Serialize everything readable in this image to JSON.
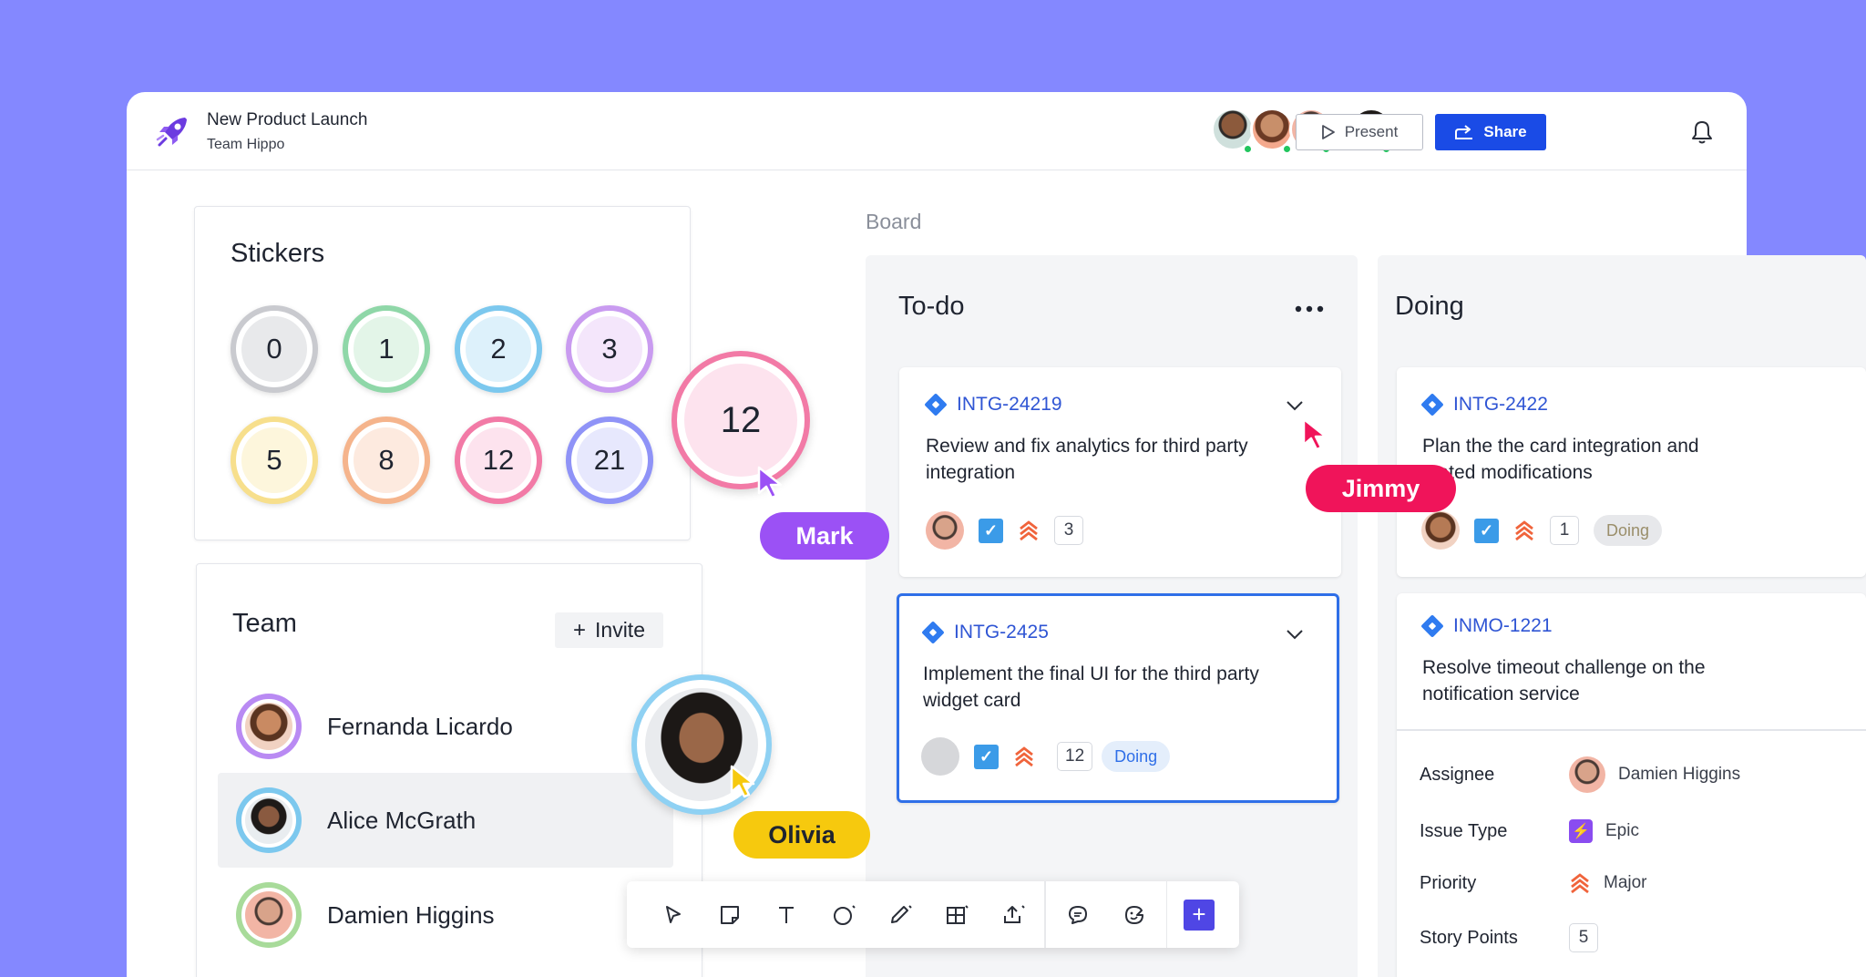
{
  "header": {
    "project_title": "New Product Launch",
    "project_subtitle": "Team Hippo",
    "present_label": "Present",
    "share_label": "Share"
  },
  "stickers": {
    "title": "Stickers",
    "items": [
      "0",
      "1",
      "2",
      "3",
      "5",
      "8",
      "12",
      "21"
    ]
  },
  "floating_sticker": {
    "value": "12"
  },
  "team": {
    "title": "Team",
    "invite_label": "Invite",
    "members": [
      "Fernanda Licardo",
      "Alice McGrath",
      "Damien Higgins"
    ]
  },
  "board": {
    "label": "Board",
    "columns": [
      {
        "title": "To-do",
        "cards": [
          {
            "id": "INTG-24219",
            "text": "Review and fix analytics for third party integration",
            "count": "3"
          },
          {
            "id": "INTG-2425",
            "text": "Implement the final UI for the third party widget card",
            "count": "12",
            "status": "Doing"
          }
        ]
      },
      {
        "title": "Doing",
        "cards": [
          {
            "id": "INTG-2422",
            "text": "Plan the the card integration and ...ated modifications",
            "count": "1",
            "status": "Doing"
          },
          {
            "id": "INMO-1221",
            "text": "Resolve timeout challenge on the notification service"
          }
        ]
      }
    ],
    "details": {
      "assignee_label": "Assignee",
      "assignee_value": "Damien Higgins",
      "issue_type_label": "Issue Type",
      "issue_type_value": "Epic",
      "priority_label": "Priority",
      "priority_value": "Major",
      "story_points_label": "Story Points",
      "story_points_value": "5"
    }
  },
  "cursors": {
    "mark": "Mark",
    "jimmy": "Jimmy",
    "olivia": "Olivia"
  },
  "colors": {
    "background": "#8488FF",
    "share_button": "#1A4BE6",
    "mark": "#9B51F5",
    "jimmy": "#F0145A",
    "olivia": "#F6C90E",
    "issue_link": "#2F55D4"
  }
}
